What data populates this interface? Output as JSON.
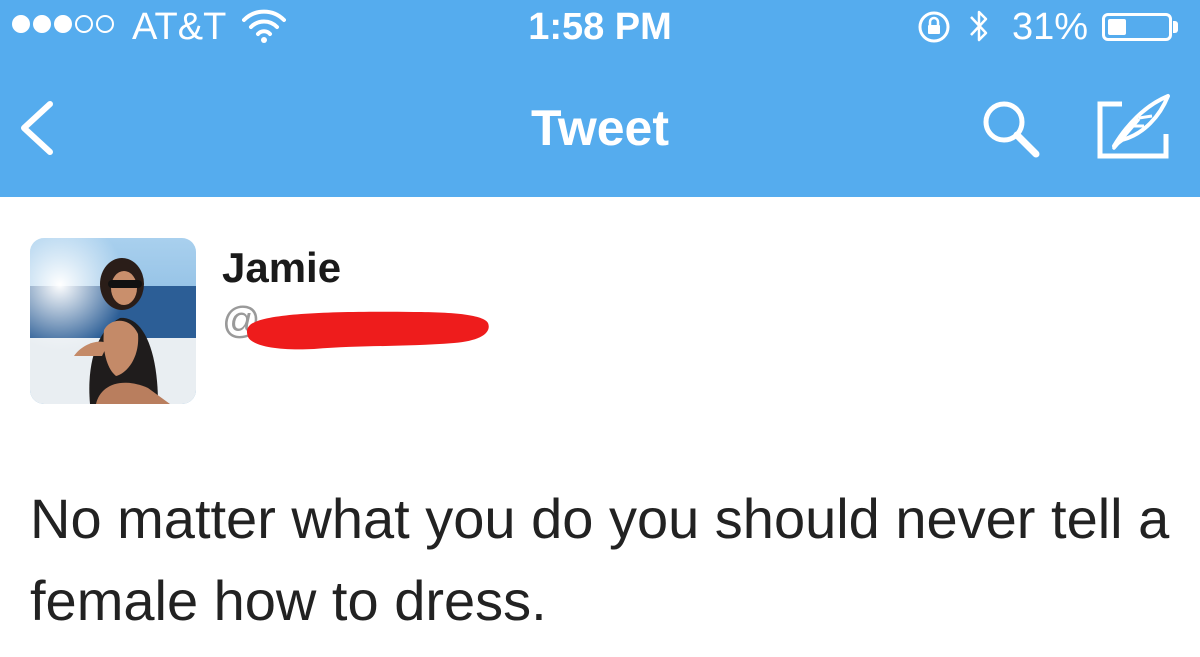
{
  "status_bar": {
    "carrier": "AT&T",
    "time": "1:58 PM",
    "battery_percent": "31%",
    "battery_level": 0.31,
    "signal_strength": 3,
    "signal_max": 5,
    "icons": [
      "signal-dots-icon",
      "wifi-icon",
      "rotation-lock-icon",
      "bluetooth-icon",
      "battery-icon"
    ]
  },
  "nav": {
    "title": "Tweet",
    "back_icon": "chevron-left-icon",
    "search_icon": "search-icon",
    "compose_icon": "compose-icon"
  },
  "tweet": {
    "author_name": "Jamie",
    "handle_prefix": "@",
    "handle_redacted": true,
    "text": "No matter what you do you should never tell a female how to dress."
  },
  "colors": {
    "brand_blue": "#55acee",
    "redaction_red": "#ee1c1c",
    "text_dark": "#222222"
  }
}
